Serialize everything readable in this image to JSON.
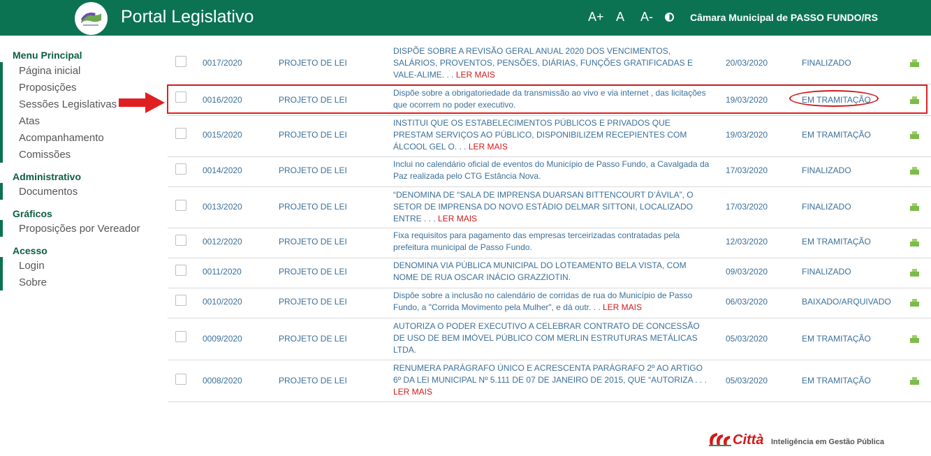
{
  "header": {
    "title": "Portal Legislativo",
    "font_increase": "A+",
    "font_normal": "A",
    "font_decrease": "A-",
    "contrast_icon": "contrast-icon",
    "camara": "Câmara Municipal de PASSO FUNDO/RS"
  },
  "sidebar": {
    "sections": [
      {
        "title": "Menu Principal",
        "items": [
          "Página inicial",
          "Proposições",
          "Sessões Legislativas",
          "Atas",
          "Acompanhamento",
          "Comissões"
        ]
      },
      {
        "title": "Administrativo",
        "items": [
          "Documentos"
        ]
      },
      {
        "title": "Gráficos",
        "items": [
          "Proposições por Vereador"
        ]
      },
      {
        "title": "Acesso",
        "items": [
          "Login",
          "Sobre"
        ]
      }
    ]
  },
  "rows": [
    {
      "number": "0017/2020",
      "type": "PROJETO DE LEI",
      "desc": [
        "DISPÕE SOBRE A REVISÃO GERAL ANUAL 2020 DOS VENCIMENTOS,",
        "SALÁRIOS, PROVENTOS, PENSÕES, DIÁRIAS, FUNÇÕES GRATIFICADAS E",
        "VALE-ALIME. . . "
      ],
      "ler_mais": "LER MAIS",
      "date": "20/03/2020",
      "status": "FINALIZADO"
    },
    {
      "number": "0016/2020",
      "type": "PROJETO DE LEI",
      "desc": [
        "Dispõe sobre a obrigatoriedade da transmissão ao vivo e via internet , das licitações",
        "que ocorrem no poder executivo."
      ],
      "ler_mais": "",
      "date": "19/03/2020",
      "status": "EM TRAMITAÇÃO"
    },
    {
      "number": "0015/2020",
      "type": "PROJETO DE LEI",
      "desc": [
        "INSTITUI QUE OS ESTABELECIMENTOS PÚBLICOS E PRIVADOS QUE",
        "PRESTAM SERVIÇOS AO PÚBLICO, DISPONIBILIZEM RECEPIENTES COM",
        "ÁLCOOL GEL O. . . "
      ],
      "ler_mais": "LER MAIS",
      "date": "19/03/2020",
      "status": "EM TRAMITAÇÃO"
    },
    {
      "number": "0014/2020",
      "type": "PROJETO DE LEI",
      "desc": [
        "Inclui no calendário oficial de eventos do Município de Passo Fundo, a Cavalgada da",
        "Paz realizada pelo CTG Estância Nova."
      ],
      "ler_mais": "",
      "date": "17/03/2020",
      "status": "FINALIZADO"
    },
    {
      "number": "0013/2020",
      "type": "PROJETO DE LEI",
      "desc": [
        "“DENOMINA DE “SALA DE IMPRENSA DUARSAN BITTENCOURT D’ÁVILA”, O",
        "SETOR DE IMPRENSA DO NOVO ESTÁDIO DELMAR SITTONI, LOCALIZADO",
        "ENTRE . . . "
      ],
      "ler_mais": "LER MAIS",
      "date": "17/03/2020",
      "status": "FINALIZADO"
    },
    {
      "number": "0012/2020",
      "type": "PROJETO DE LEI",
      "desc": [
        "Fixa requisitos para pagamento das empresas terceirizadas contratadas pela",
        "prefeitura municipal de Passo Fundo."
      ],
      "ler_mais": "",
      "date": "12/03/2020",
      "status": "EM TRAMITAÇÃO"
    },
    {
      "number": "0011/2020",
      "type": "PROJETO DE LEI",
      "desc": [
        "DENOMINA VIA PÚBLICA MUNICIPAL DO LOTEAMENTO BELA VISTA, COM",
        "NOME DE RUA OSCAR INÁCIO GRAZZIOTIN."
      ],
      "ler_mais": "",
      "date": "09/03/2020",
      "status": "FINALIZADO"
    },
    {
      "number": "0010/2020",
      "type": "PROJETO DE LEI",
      "desc": [
        "Dispõe sobre a inclusão no calendário de corridas de rua do Município de Passo",
        "Fundo, a \"Corrida Movimento pela Mulher\", e dá outr. . . "
      ],
      "ler_mais": "LER MAIS",
      "date": "06/03/2020",
      "status": "BAIXADO/ARQUIVADO"
    },
    {
      "number": "0009/2020",
      "type": "PROJETO DE LEI",
      "desc": [
        "AUTORIZA O PODER EXECUTIVO A CELEBRAR CONTRATO DE CONCESSÃO",
        "DE USO DE BEM IMÓVEL PÚBLICO COM MERLIN ESTRUTURAS METÁLICAS",
        "LTDA."
      ],
      "ler_mais": "",
      "date": "05/03/2020",
      "status": "EM TRAMITAÇÃO"
    },
    {
      "number": "0008/2020",
      "type": "PROJETO DE LEI",
      "desc": [
        "RENUMERA PARÁGRAFO ÚNICO E ACRESCENTA PARÁGRAFO 2º AO ARTIGO",
        "6º DA LEI MUNICIPAL Nº 5.111 DE 07 DE JANEIRO DE 2015, QUE “AUTORIZA . . .",
        ""
      ],
      "ler_mais": "LER MAIS",
      "date": "05/03/2020",
      "status": "EM TRAMITAÇÃO"
    }
  ],
  "print_icon": "print-icon",
  "footer": {
    "brand": "Città",
    "tagline": "Inteligência em Gestão Pública"
  },
  "colors": {
    "header_bg": "#0b7351",
    "link": "#3a6f99",
    "highlight": "#e02020"
  }
}
